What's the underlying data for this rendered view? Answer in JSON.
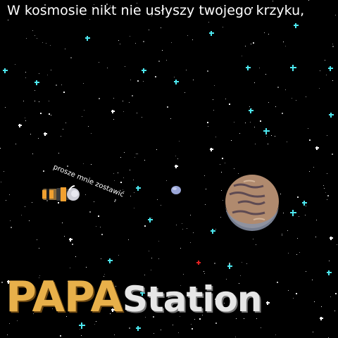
{
  "title": "W kosmosie nikt nie usłyszy twojego krzyku,",
  "subtitle": "",
  "speech_bubble": "prosze mnie zostawić",
  "logo": {
    "part1": "PAPA",
    "part2": "Station"
  },
  "colors": {
    "background": "#000000",
    "star_white": "#ffffff",
    "star_cyan": "#4de8f0",
    "logo_papa": "#e8b04a",
    "logo_station": "#e6e6e6",
    "planet": "#b08a6e",
    "moon": "#9aa6d8",
    "astronaut_suit": "#f0a030"
  },
  "icons": {
    "planet": "planet-icon",
    "astronaut": "astronaut-icon",
    "moon": "moon-icon",
    "red_star": "red-star-icon"
  }
}
